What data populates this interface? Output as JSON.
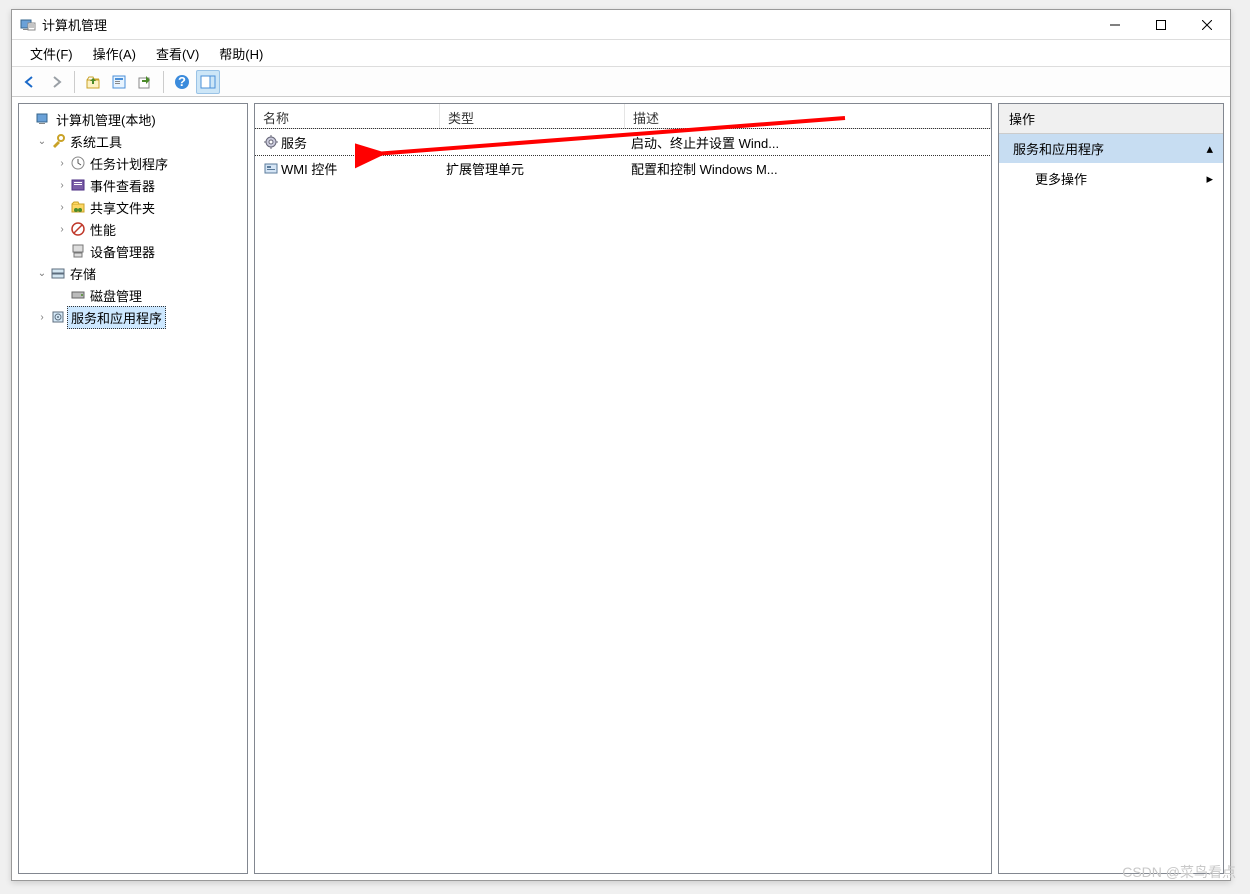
{
  "title": "计算机管理",
  "menubar": {
    "file": "文件(F)",
    "action": "操作(A)",
    "view": "查看(V)",
    "help": "帮助(H)"
  },
  "tree": {
    "root": "计算机管理(本地)",
    "system_tools": "系统工具",
    "task_scheduler": "任务计划程序",
    "event_viewer": "事件查看器",
    "shared_folders": "共享文件夹",
    "performance": "性能",
    "device_manager": "设备管理器",
    "storage": "存储",
    "disk_management": "磁盘管理",
    "services_and_applications": "服务和应用程序"
  },
  "columns": {
    "name": "名称",
    "type": "类型",
    "description": "描述"
  },
  "list": {
    "row1": {
      "name": "服务",
      "type": "",
      "desc": "启动、终止并设置 Wind..."
    },
    "row2": {
      "name": "WMI 控件",
      "type": "扩展管理单元",
      "desc": "配置和控制 Windows M..."
    }
  },
  "actions": {
    "header": "操作",
    "subheader": "服务和应用程序",
    "more": "更多操作"
  },
  "watermark": "CSDN @菜鸟看点"
}
